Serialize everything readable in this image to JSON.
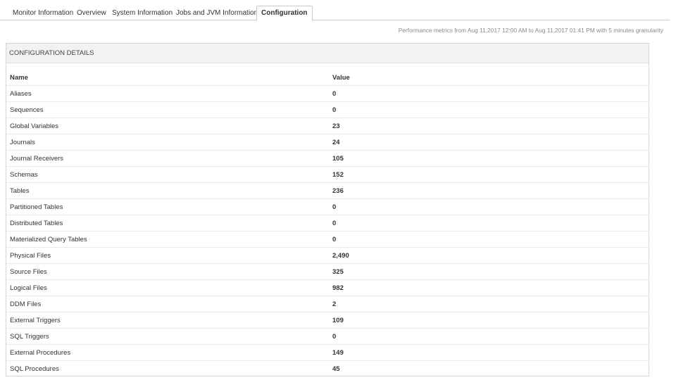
{
  "tabs": [
    {
      "label": "Monitor Information",
      "active": false
    },
    {
      "label": "Overview",
      "active": false
    },
    {
      "label": "System Information",
      "active": false
    },
    {
      "label": "Jobs and JVM Information",
      "active": false
    },
    {
      "label": "Configuration",
      "active": true
    }
  ],
  "perf_note": "Performance metrics from Aug 11,2017 12:00 AM to Aug 11,2017 01:41 PM with 5 minutes granularity",
  "panel": {
    "title": "CONFIGURATION DETAILS",
    "columns": {
      "name": "Name",
      "value": "Value"
    },
    "rows": [
      {
        "name": "Aliases",
        "value": "0"
      },
      {
        "name": "Sequences",
        "value": "0"
      },
      {
        "name": "Global Variables",
        "value": "23"
      },
      {
        "name": "Journals",
        "value": "24"
      },
      {
        "name": "Journal Receivers",
        "value": "105"
      },
      {
        "name": "Schemas",
        "value": "152"
      },
      {
        "name": "Tables",
        "value": "236"
      },
      {
        "name": "Partitioned Tables",
        "value": "0"
      },
      {
        "name": "Distributed Tables",
        "value": "0"
      },
      {
        "name": "Materialized Query Tables",
        "value": "0"
      },
      {
        "name": "Physical Files",
        "value": "2,490"
      },
      {
        "name": "Source Files",
        "value": "325"
      },
      {
        "name": "Logical Files",
        "value": "982"
      },
      {
        "name": "DDM Files",
        "value": "2"
      },
      {
        "name": "External Triggers",
        "value": "109"
      },
      {
        "name": "SQL Triggers",
        "value": "0"
      },
      {
        "name": "External Procedures",
        "value": "149"
      },
      {
        "name": "SQL Procedures",
        "value": "45"
      }
    ]
  }
}
